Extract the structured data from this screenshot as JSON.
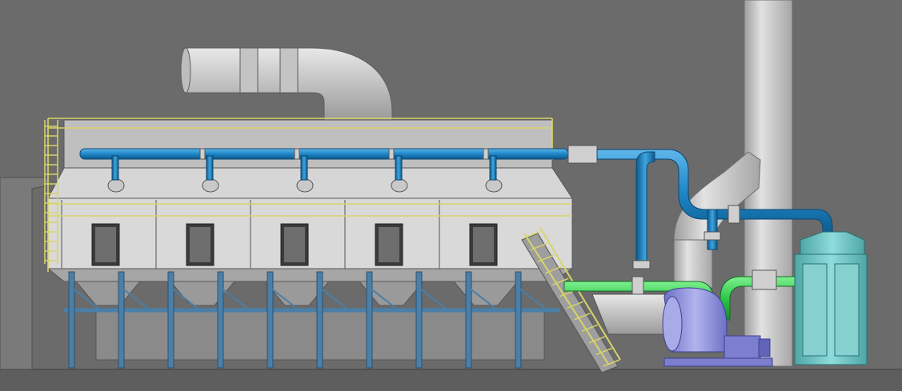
{
  "scene": {
    "type": "3D CAD rendering of an industrial exhaust treatment system",
    "background_color": "#6b6b6b",
    "colors": {
      "pipe_blue": "#1e86c8",
      "pipe_green": "#2ec84a",
      "structure_light": "#d9d9d9",
      "structure_mid": "#b8b8b8",
      "frame_steel": "#4a7fa8",
      "railing_yellow": "#d8d468",
      "fan_purple": "#8d8fd6",
      "filter_cyan": "#6fc4c4",
      "stack_gray": "#c9c9c9"
    },
    "components": {
      "bed_units": 5,
      "support_columns": 10,
      "stair_steps": 12
    }
  }
}
